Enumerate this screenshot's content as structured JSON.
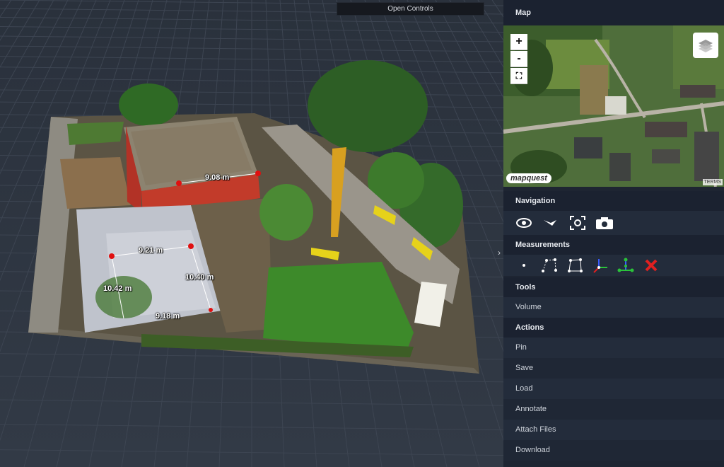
{
  "viewport": {
    "open_controls_label": "Open Controls",
    "measurement_labels": [
      "9.08 m",
      "9.21 m",
      "10.40 m",
      "10.42 m",
      "9.18 m"
    ]
  },
  "sidebar": {
    "map_title": "Map",
    "map": {
      "zoom_in": "+",
      "zoom_out": "-",
      "logo": "mapquest",
      "terms": "TERMS"
    },
    "navigation_title": "Navigation",
    "navigation_icons": [
      "orbit-control-icon",
      "fly-control-icon",
      "focus-extent-icon",
      "screenshot-camera-icon"
    ],
    "measurements_title": "Measurements",
    "measurement_icons": [
      "point-measure-icon",
      "distance-measure-icon",
      "area-measure-icon",
      "angle-measure-icon",
      "height-measure-icon",
      "remove-measurements-icon"
    ],
    "tools_title": "Tools",
    "tools_items": [
      "Volume"
    ],
    "actions_title": "Actions",
    "actions_items": [
      "Pin",
      "Save",
      "Load",
      "Annotate",
      "Attach Files",
      "Download"
    ]
  },
  "colors": {
    "background": "#2b323d",
    "sidebar": "#1e2532",
    "marker": "#e01010",
    "remove": "#e02020"
  }
}
